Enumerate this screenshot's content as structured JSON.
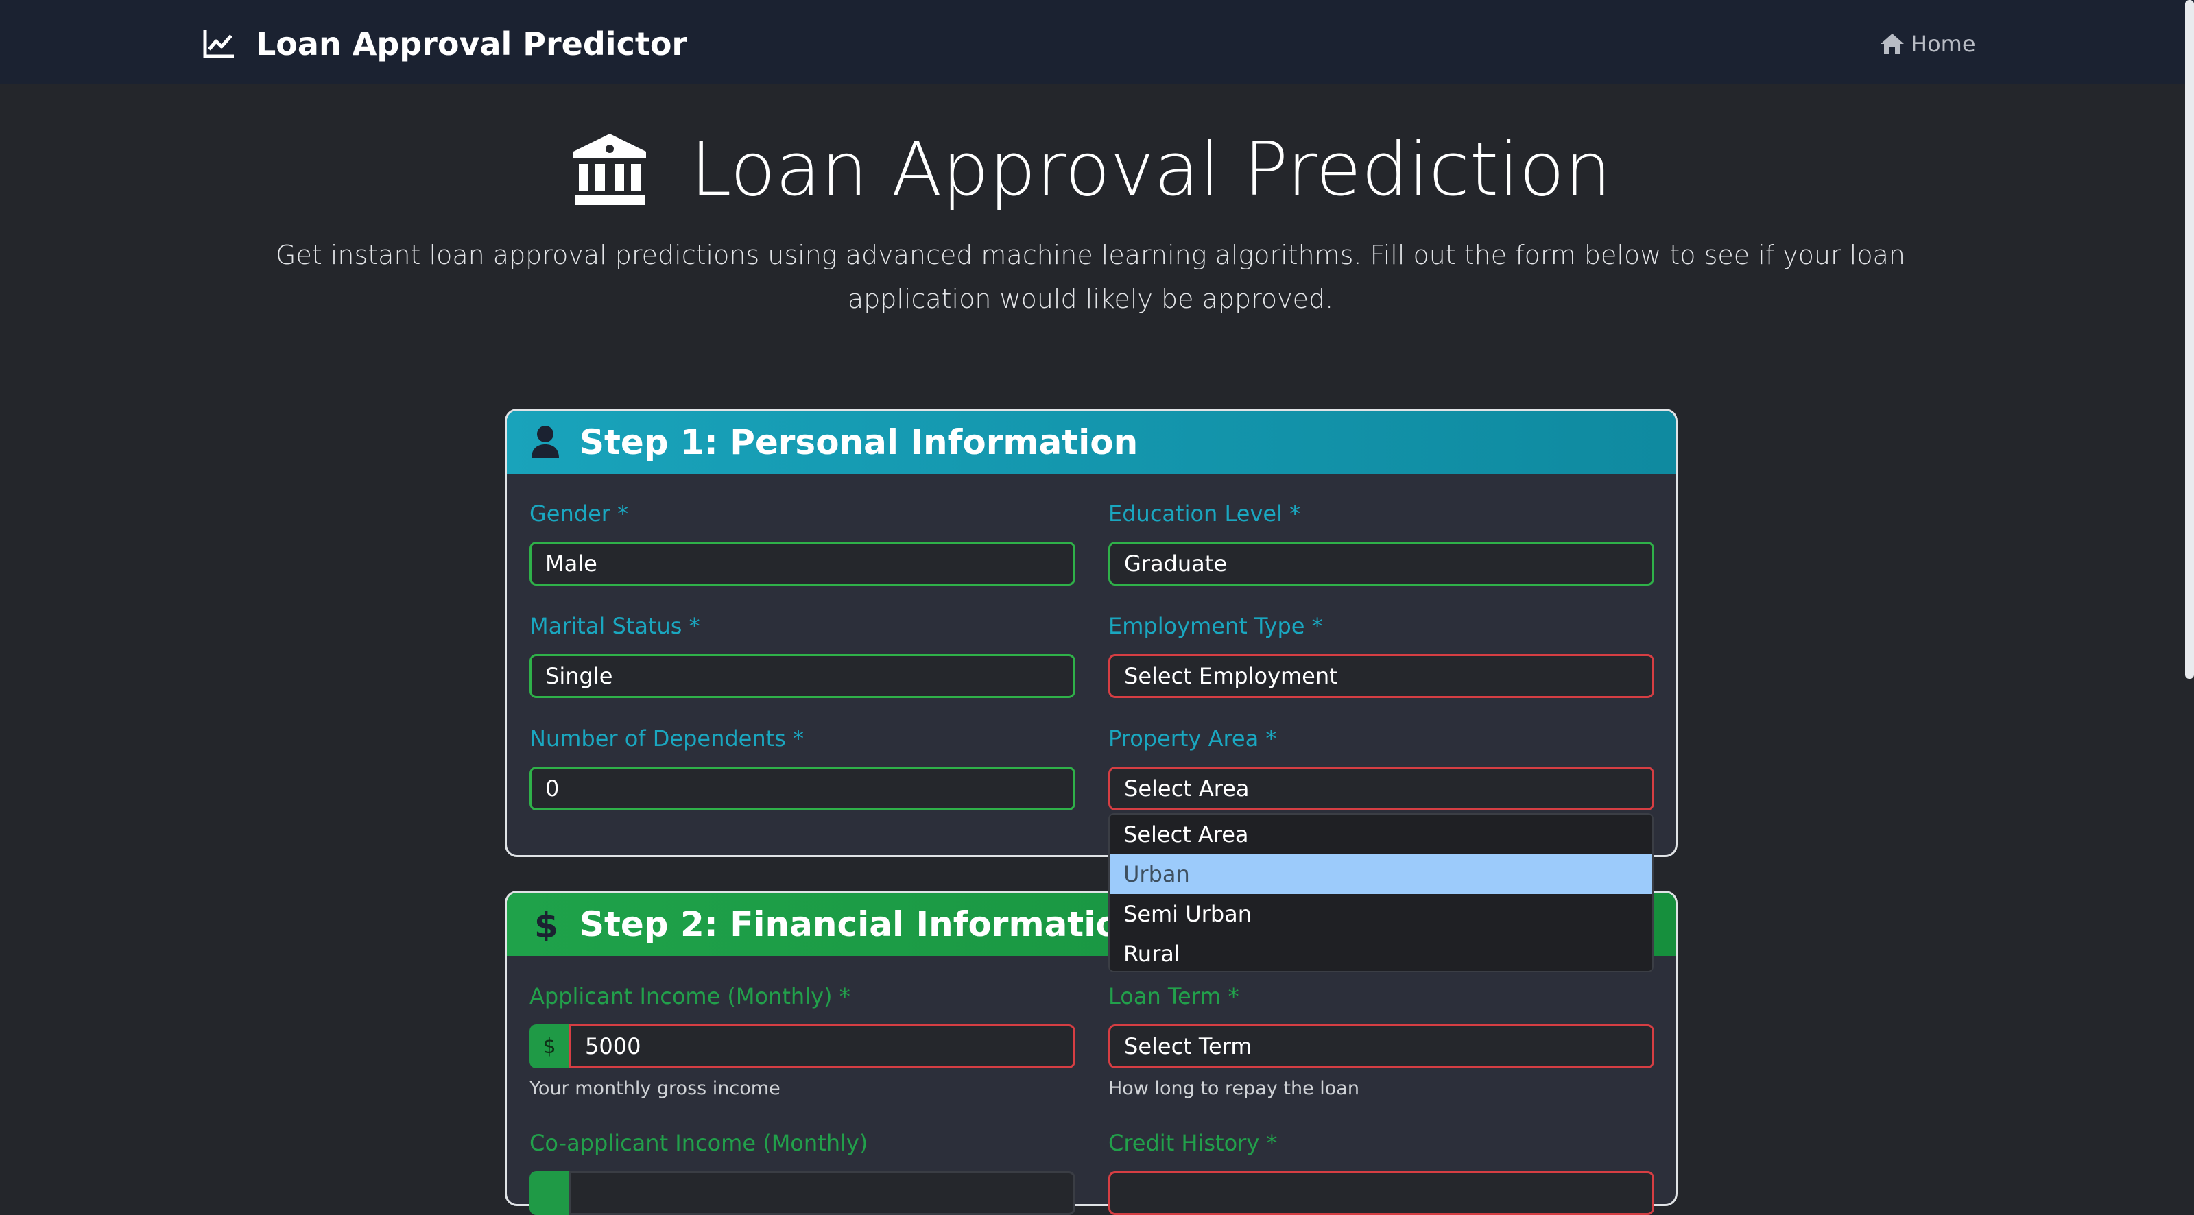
{
  "navbar": {
    "brand_icon": "chart-line-icon",
    "brand": "Loan Approval Predictor",
    "home_icon": "home-icon",
    "home": "Home"
  },
  "hero": {
    "icon": "bank-building-icon",
    "title": "Loan Approval Prediction",
    "subtitle": "Get instant loan approval predictions using advanced machine learning algorithms. Fill out the form below to see if your loan application would likely be approved."
  },
  "colors": {
    "step1_header": "#17a2b8",
    "step2_header": "#1fa24a",
    "valid_border": "#2fb149",
    "invalid_border": "#d63e43",
    "dropdown_highlight": "#9ccbfb"
  },
  "step1": {
    "icon": "user-icon",
    "title": "Step 1: Personal Information",
    "gender": {
      "label": "Gender *",
      "value": "Male"
    },
    "education": {
      "label": "Education Level *",
      "value": "Graduate"
    },
    "marital": {
      "label": "Marital Status *",
      "value": "Single"
    },
    "employment": {
      "label": "Employment Type *",
      "value": "Select Employment"
    },
    "dependents": {
      "label": "Number of Dependents *",
      "value": "0"
    },
    "property": {
      "label": "Property Area *",
      "value": "Select Area"
    }
  },
  "property_dropdown": {
    "options": [
      "Select Area",
      "Urban",
      "Semi Urban",
      "Rural"
    ],
    "highlighted": "Urban"
  },
  "step2": {
    "icon": "dollar-icon",
    "title": "Step 2: Financial Information",
    "applicant_income": {
      "label": "Applicant Income (Monthly) *",
      "prefix": "$",
      "value": "5000",
      "help": "Your monthly gross income"
    },
    "loan_term": {
      "label": "Loan Term *",
      "value": "Select Term",
      "help": "How long to repay the loan"
    },
    "coapplicant_income": {
      "label": "Co-applicant Income (Monthly)"
    },
    "credit_history": {
      "label": "Credit History *"
    }
  }
}
